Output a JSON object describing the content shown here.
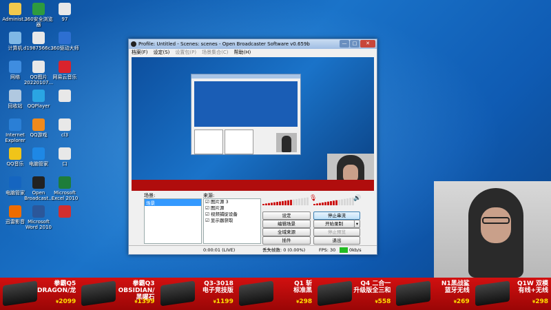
{
  "desktop": {
    "icons": [
      {
        "label": "Administ...",
        "color": "#f2c94c"
      },
      {
        "label": "360安全浏览器",
        "color": "#2e9b3f"
      },
      {
        "label": "97",
        "color": "#e8e8e8"
      },
      {
        "label": "计算机",
        "color": "#7fb8e6"
      },
      {
        "label": "d1987566c...",
        "color": "#e8e8e8"
      },
      {
        "label": "360驱动大师",
        "color": "#2d6fd1"
      },
      {
        "label": "网络",
        "color": "#3f8de0"
      },
      {
        "label": "QQ图片20220107...",
        "color": "#e8e8e8"
      },
      {
        "label": "网易云音乐",
        "color": "#d9232d"
      },
      {
        "label": "回收站",
        "color": "#b0c8e0"
      },
      {
        "label": "QQPlayer",
        "color": "#2aa5e3"
      },
      {
        "label": "",
        "color": "#e8e8e8"
      },
      {
        "label": "Internet Explorer",
        "color": "#2a7fd6"
      },
      {
        "label": "QQ游戏",
        "color": "#f08a1c"
      },
      {
        "label": "cl3",
        "color": "#e8e8e8"
      },
      {
        "label": "QQ音乐",
        "color": "#f0c419"
      },
      {
        "label": "电脑管家",
        "color": "#1e88e5"
      },
      {
        "label": "口",
        "color": "#e8e8e8"
      },
      {
        "label": "电脑管家",
        "color": "#1565c0"
      },
      {
        "label": "Open Broadcast...",
        "color": "#222222"
      },
      {
        "label": "Microsoft Excel 2010",
        "color": "#1e7d3a"
      },
      {
        "label": "迅雷影音",
        "color": "#ef6c00"
      },
      {
        "label": "Microsoft Word 2010",
        "color": "#2b579a"
      },
      {
        "label": "",
        "color": "#d32f2f"
      }
    ]
  },
  "obs": {
    "title": "Profile: Untitled - Scenes: scenes - Open Broadcaster Software v0.659b",
    "menu": [
      "档案(F)",
      "设定(S)",
      "设置包(P)",
      "场景集合(C)",
      "帮助(H)"
    ],
    "scenes_label": "场景:",
    "scenes": [
      "场景"
    ],
    "sources_label": "来源:",
    "sources": [
      "图片源 3",
      "图片源",
      "视频捕捉设备",
      "显示器获取"
    ],
    "buttons": {
      "settings": "设定",
      "stop_stream": "停止串流",
      "edit_scene": "编辑场景",
      "start_record": "开始录制",
      "global_sources": "全域来源",
      "preview": "停止预览",
      "plugins": "插件",
      "exit": "退出"
    },
    "status": {
      "time": "0:00:01 (LIVE)",
      "dropped": "丢失帧数: 0 (0.00%)",
      "fps": "FPS: 30",
      "bitrate": "0kb/s"
    }
  },
  "banner": {
    "products": [
      {
        "name": "拳霸Q5\nDRAGON/龙",
        "price": "2099"
      },
      {
        "name": "拳霸Q3\nOBSIDIAN/\n黑曜石",
        "price": "1399"
      },
      {
        "name": "Q3-3018\n电子竞技版",
        "price": "1199"
      },
      {
        "name": "Q1 斩\n标准黑",
        "price": "298"
      },
      {
        "name": "Q4 二合一\n升级版全三和",
        "price": "558"
      },
      {
        "name": "N1黑战鲨\n蓝牙无线",
        "price": "269"
      },
      {
        "name": "Q1W 双模\n有线+无线",
        "price": "298"
      }
    ],
    "currency": "¥"
  }
}
